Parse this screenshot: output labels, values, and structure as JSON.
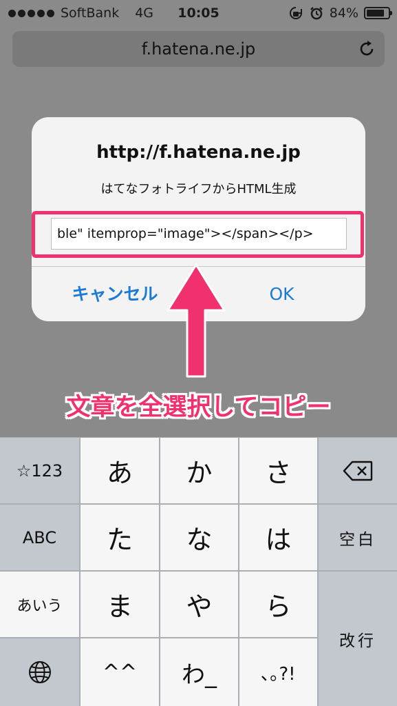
{
  "status_bar": {
    "carrier": "SoftBank",
    "network": "4G",
    "time": "10:05",
    "battery_percent": "84%",
    "battery_level": 0.84,
    "icons": [
      "orientation-lock-icon",
      "alarm-icon",
      "battery-icon"
    ]
  },
  "browser": {
    "url": "f.hatena.ne.jp",
    "reload_icon": "reload-icon"
  },
  "dialog": {
    "title": "http://f.hatena.ne.jp",
    "message": "はてなフォトライフからHTML生成",
    "input_value": "ble\" itemprop=\"image\"></span></p>",
    "cancel_label": "キャンセル",
    "ok_label": "OK"
  },
  "annotation": {
    "caption": "文章を全選択してコピー",
    "color": "#f0316d"
  },
  "keyboard": {
    "left_column": [
      "☆123",
      "ABC",
      "あいう"
    ],
    "globe_icon": "globe-icon",
    "rows": [
      [
        "あ",
        "か",
        "さ"
      ],
      [
        "た",
        "な",
        "は"
      ],
      [
        "ま",
        "や",
        "ら"
      ],
      [
        "^^",
        "わ_",
        "､｡?!"
      ]
    ],
    "delete_icon": "backspace-icon",
    "space_label": "空白",
    "return_label": "改行"
  },
  "colors": {
    "link_blue": "#1a7ad6",
    "highlight_pink": "#f0316d"
  }
}
